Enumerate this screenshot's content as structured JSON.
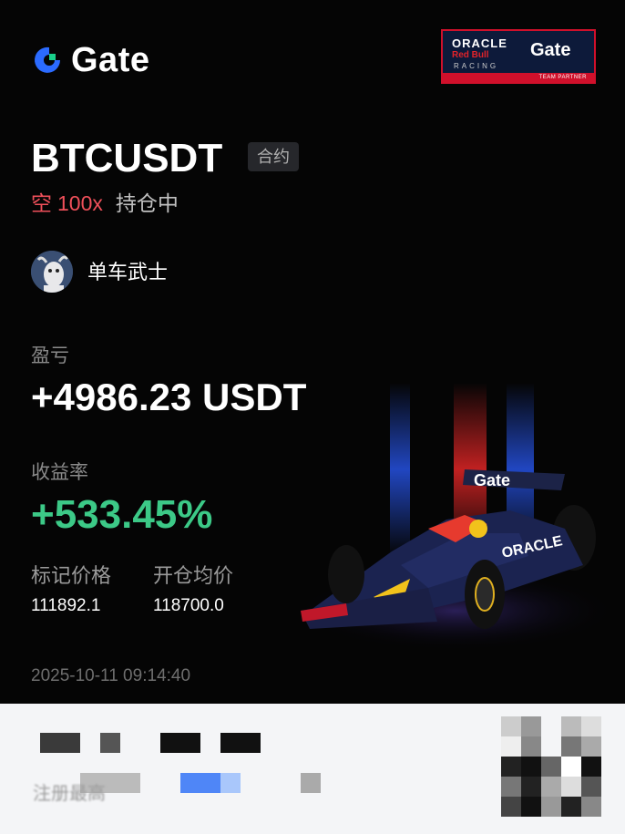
{
  "brand": {
    "name": "Gate"
  },
  "partner_badge": {
    "oracle": "ORACLE",
    "redbull": "Red Bull",
    "racing": "RACING",
    "gate": "Gate",
    "tagline": "TEAM PARTNER"
  },
  "position": {
    "symbol": "BTCUSDT",
    "type_badge": "合约",
    "side": "空",
    "leverage": "100x",
    "status": "持仓中"
  },
  "user": {
    "name": "单车武士"
  },
  "pnl": {
    "label": "盈亏",
    "value": "+4986.23 USDT"
  },
  "roi": {
    "label": "收益率",
    "value": "+533.45%"
  },
  "prices": {
    "mark_label": "标记价格",
    "mark_value": "111892.1",
    "entry_label": "开仓均价",
    "entry_value": "118700.0"
  },
  "timestamp": "2025-10-11 09:14:40",
  "footer": {
    "register_text": "注册最高"
  },
  "colors": {
    "short": "#f0505a",
    "profit": "#3cc987",
    "accent_blue": "#2b6bff",
    "accent_green": "#19d18a",
    "partner_red": "#d0102b",
    "partner_navy": "#0d1a3a"
  }
}
